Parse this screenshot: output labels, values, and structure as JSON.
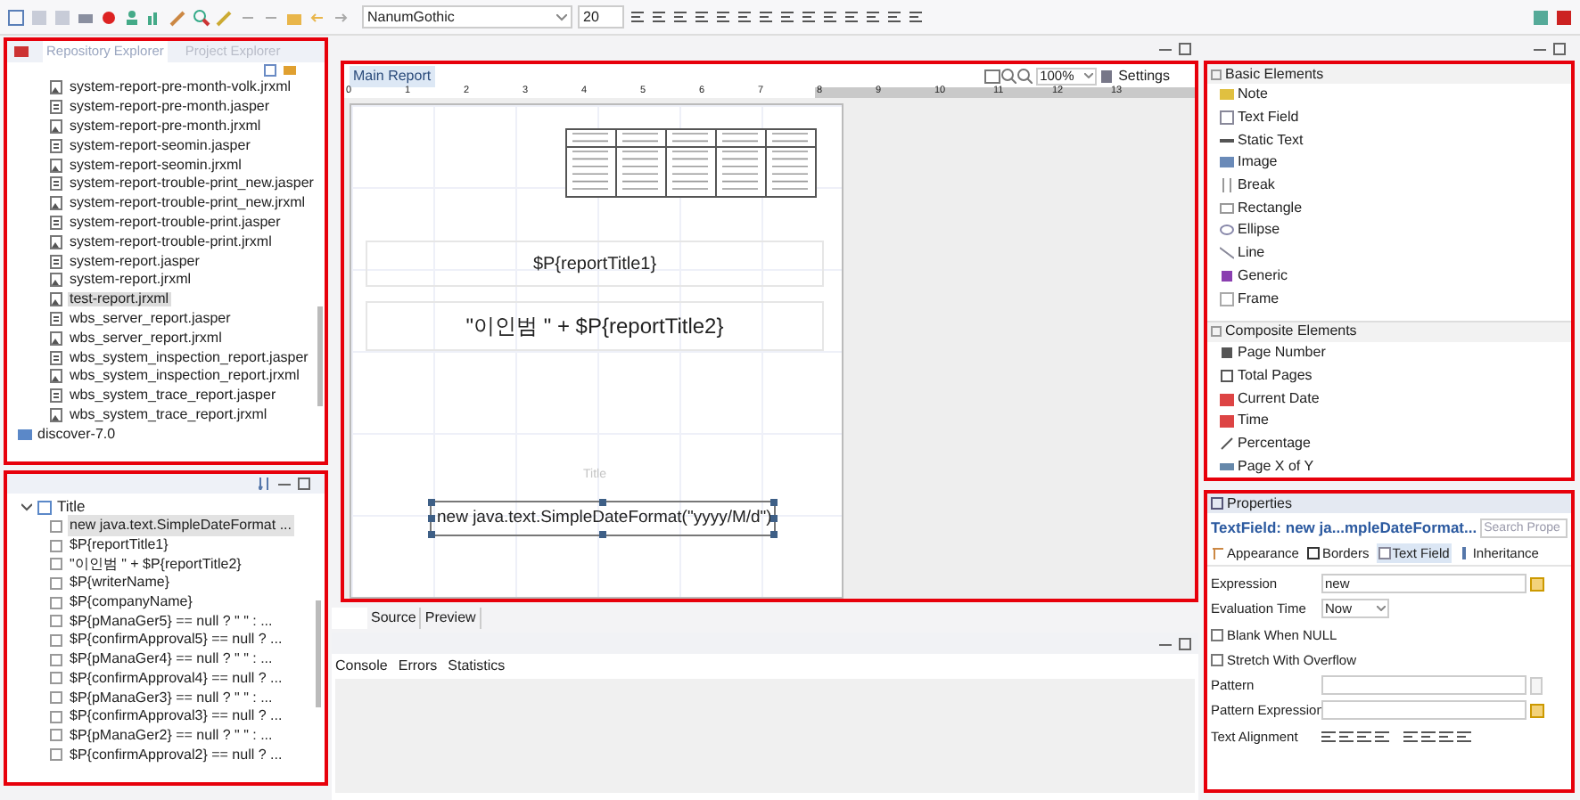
{
  "toolbar": {
    "font": "NanumGothic",
    "font_size": "20"
  },
  "explorer": {
    "tabs": [
      {
        "label": "Repository Explorer",
        "selected": true
      },
      {
        "label": "Project Explorer",
        "selected": false
      }
    ],
    "files": [
      {
        "name": "system-report-pre-month-volk.jrxml",
        "kind": "jrxml",
        "selected": false
      },
      {
        "name": "system-report-pre-month.jasper",
        "kind": "jasper",
        "selected": false
      },
      {
        "name": "system-report-pre-month.jrxml",
        "kind": "jrxml",
        "selected": false
      },
      {
        "name": "system-report-seomin.jasper",
        "kind": "jasper",
        "selected": false
      },
      {
        "name": "system-report-seomin.jrxml",
        "kind": "jrxml",
        "selected": false
      },
      {
        "name": "system-report-trouble-print_new.jasper",
        "kind": "jasper",
        "selected": false
      },
      {
        "name": "system-report-trouble-print_new.jrxml",
        "kind": "jrxml",
        "selected": false
      },
      {
        "name": "system-report-trouble-print.jasper",
        "kind": "jasper",
        "selected": false
      },
      {
        "name": "system-report-trouble-print.jrxml",
        "kind": "jrxml",
        "selected": false
      },
      {
        "name": "system-report.jasper",
        "kind": "jasper",
        "selected": false
      },
      {
        "name": "system-report.jrxml",
        "kind": "jrxml",
        "selected": false
      },
      {
        "name": "test-report.jrxml",
        "kind": "jrxml",
        "selected": true
      },
      {
        "name": "wbs_server_report.jasper",
        "kind": "jasper",
        "selected": false
      },
      {
        "name": "wbs_server_report.jrxml",
        "kind": "jrxml",
        "selected": false
      },
      {
        "name": "wbs_system_inspection_report.jasper",
        "kind": "jasper",
        "selected": false
      },
      {
        "name": "wbs_system_inspection_report.jrxml",
        "kind": "jrxml",
        "selected": false
      },
      {
        "name": "wbs_system_trace_report.jasper",
        "kind": "jasper",
        "selected": false
      },
      {
        "name": "wbs_system_trace_report.jrxml",
        "kind": "jrxml",
        "selected": false
      }
    ],
    "folder": "discover-7.0"
  },
  "outline": {
    "label": "Title",
    "expanded": true,
    "children": [
      {
        "label": "new java.text.SimpleDateFormat ...",
        "selected": true
      },
      {
        "label": "$P{reportTitle1}",
        "selected": false
      },
      {
        "label": "\"이인범 \" + $P{reportTitle2}",
        "selected": false
      },
      {
        "label": "$P{writerName}",
        "selected": false
      },
      {
        "label": "$P{companyName}",
        "selected": false
      },
      {
        "label": "$P{pManaGer5} == null ? \" \" : ...",
        "selected": false
      },
      {
        "label": "$P{confirmApproval5} == null ? ...",
        "selected": false
      },
      {
        "label": "$P{pManaGer4} == null ? \" \" : ...",
        "selected": false
      },
      {
        "label": "$P{confirmApproval4} == null ? ...",
        "selected": false
      },
      {
        "label": "$P{pManaGer3} == null ? \" \" : ...",
        "selected": false
      },
      {
        "label": "$P{confirmApproval3} == null ? ...",
        "selected": false
      },
      {
        "label": "$P{pManaGer2} == null ? \" \" : ...",
        "selected": false
      },
      {
        "label": "$P{confirmApproval2} == null ? ...",
        "selected": false
      }
    ]
  },
  "editor": {
    "tab": "Main Report",
    "zoom": "100%",
    "settings": "Settings",
    "ruler": [
      "0",
      "1",
      "2",
      "3",
      "4",
      "5",
      "6",
      "7",
      "8",
      "9",
      "10",
      "11",
      "12",
      "13"
    ],
    "title1": "$P{reportTitle1}",
    "title2": "\"이인범 \" + $P{reportTitle2}",
    "band": "Title",
    "selected_field": "new java.text.SimpleDateFormat(\"yyyy/M/d\")",
    "bottom_tabs": [
      {
        "label": "Source",
        "selected": false
      },
      {
        "label": "Preview",
        "selected": false
      }
    ]
  },
  "console": {
    "tabs": [
      "Console",
      "Errors",
      "Statistics"
    ]
  },
  "palette": {
    "groups": [
      {
        "title": "Basic Elements",
        "items": [
          "Note",
          "Text Field",
          "Static Text",
          "Image",
          "Break",
          "Rectangle",
          "Ellipse",
          "Line",
          "Generic",
          "Frame"
        ]
      },
      {
        "title": "Composite Elements",
        "items": [
          "Page Number",
          "Total Pages",
          "Current Date",
          "Time",
          "Percentage",
          "Page X of Y"
        ]
      }
    ]
  },
  "properties": {
    "tab": "Properties",
    "title": "TextField: new ja...mpleDateFormat...",
    "search_placeholder": "Search Prope",
    "tabs": [
      {
        "label": "Appearance",
        "selected": false
      },
      {
        "label": "Borders",
        "selected": false
      },
      {
        "label": "Text Field",
        "selected": true
      },
      {
        "label": "Inheritance",
        "selected": false
      }
    ],
    "fields": [
      {
        "kind": "text",
        "label": "Expression",
        "value": "new"
      },
      {
        "kind": "select",
        "label": "Evaluation Time",
        "value": "Now"
      },
      {
        "kind": "checkbox",
        "label": "Blank When NULL",
        "checked": false
      },
      {
        "kind": "checkbox",
        "label": "Stretch With Overflow",
        "checked": false
      },
      {
        "kind": "text",
        "label": "Pattern"
      },
      {
        "kind": "spinner",
        "label": "Pattern Expression"
      },
      {
        "kind": "alignment",
        "label": "Text Alignment"
      }
    ]
  }
}
